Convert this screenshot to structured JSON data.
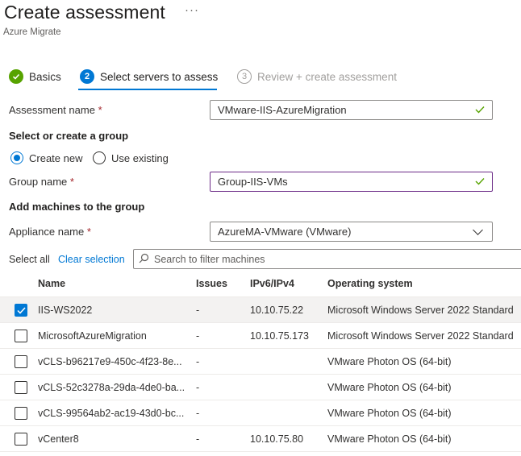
{
  "header": {
    "title": "Create assessment",
    "more": "···",
    "subtitle": "Azure Migrate"
  },
  "steps": [
    {
      "number": "1",
      "label": "Basics",
      "state": "done"
    },
    {
      "number": "2",
      "label": "Select servers to assess",
      "state": "active"
    },
    {
      "number": "3",
      "label": "Review + create assessment",
      "state": "disabled"
    }
  ],
  "form": {
    "assessment_name_label": "Assessment name",
    "assessment_name_value": "VMware-IIS-AzureMigration",
    "required_mark": "*",
    "group_section": "Select or create a group",
    "radio_create": "Create new",
    "radio_existing": "Use existing",
    "group_name_label": "Group name",
    "group_name_value": "Group-IIS-VMs",
    "machines_section": "Add machines to the group",
    "appliance_label": "Appliance name",
    "appliance_value": "AzureMA-VMware (VMware)"
  },
  "toolbar": {
    "select_all": "Select all",
    "clear_selection": "Clear selection",
    "search_placeholder": "Search to filter machines"
  },
  "table": {
    "headers": {
      "name": "Name",
      "issues": "Issues",
      "ip": "IPv6/IPv4",
      "os": "Operating system"
    },
    "rows": [
      {
        "checked": true,
        "name": "IIS-WS2022",
        "issues": "-",
        "ip": "10.10.75.22",
        "os": "Microsoft Windows Server 2022 Standard"
      },
      {
        "checked": false,
        "name": "MicrosoftAzureMigration",
        "issues": "-",
        "ip": "10.10.75.173",
        "os": "Microsoft Windows Server 2022 Standard"
      },
      {
        "checked": false,
        "name": "vCLS-b96217e9-450c-4f23-8e...",
        "issues": "-",
        "ip": "",
        "os": "VMware Photon OS (64-bit)"
      },
      {
        "checked": false,
        "name": "vCLS-52c3278a-29da-4de0-ba...",
        "issues": "-",
        "ip": "",
        "os": "VMware Photon OS (64-bit)"
      },
      {
        "checked": false,
        "name": "vCLS-99564ab2-ac19-43d0-bc...",
        "issues": "-",
        "ip": "",
        "os": "VMware Photon OS (64-bit)"
      },
      {
        "checked": false,
        "name": "vCenter8",
        "issues": "-",
        "ip": "10.10.75.80",
        "os": "VMware Photon OS (64-bit)"
      }
    ]
  },
  "colors": {
    "accent": "#0078d4",
    "success": "#57a300",
    "required": "#a4262c"
  }
}
